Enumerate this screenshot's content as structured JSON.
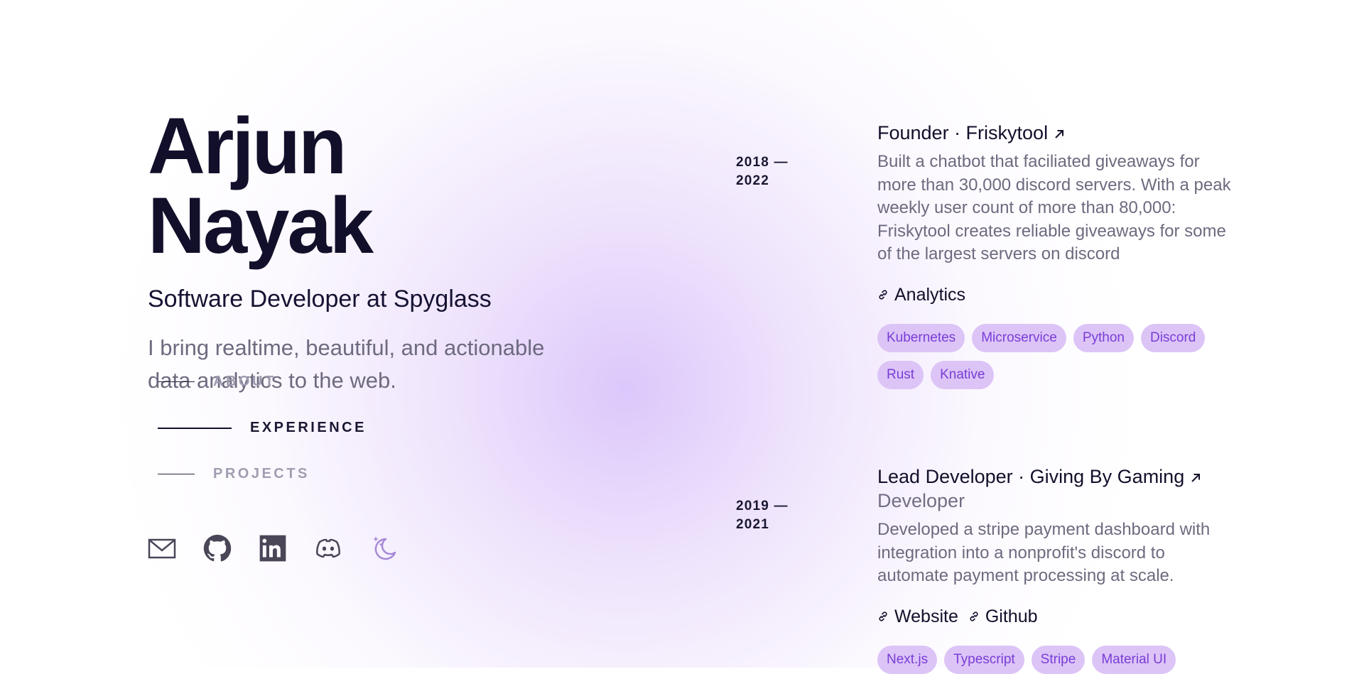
{
  "profile": {
    "name": "Arjun Nayak",
    "role": "Software Developer at Spyglass",
    "tagline": "I bring realtime, beautiful, and actionable data analytics to the web."
  },
  "nav": {
    "items": [
      {
        "label": "ABOUT",
        "active": false
      },
      {
        "label": "EXPERIENCE",
        "active": true
      },
      {
        "label": "PROJECTS",
        "active": false
      }
    ]
  },
  "social": {
    "icons": [
      "mail-icon",
      "github-icon",
      "linkedin-icon",
      "discord-icon",
      "moon-stars-icon"
    ]
  },
  "experience": [
    {
      "period_start": "2018 —",
      "period_end": "2022",
      "title": "Founder · Friskytool",
      "subtitle": "",
      "description": "Built a chatbot that faciliated giveaways for more than 30,000 discord servers. With a peak weekly user count of more than 80,000: Friskytool creates reliable giveaways for some of the largest servers on discord",
      "links": [
        "Analytics"
      ],
      "tags": [
        "Kubernetes",
        "Microservice",
        "Python",
        "Discord",
        "Rust",
        "Knative"
      ]
    },
    {
      "period_start": "2019 —",
      "period_end": "2021",
      "title": "Lead Developer · Giving By Gaming",
      "subtitle": "Developer",
      "description": "Developed a stripe payment dashboard with integration into a nonprofit's discord to automate payment processing at scale.",
      "links": [
        "Website",
        "Github"
      ],
      "tags": [
        "Next.js",
        "Typescript",
        "Stripe",
        "Material UI"
      ]
    }
  ],
  "colors": {
    "accent": "#7a3dd6",
    "tag_background": "#dcc4f7",
    "heading": "#120f2a",
    "muted": "#6e6a7f",
    "glow": "#d6befa"
  }
}
